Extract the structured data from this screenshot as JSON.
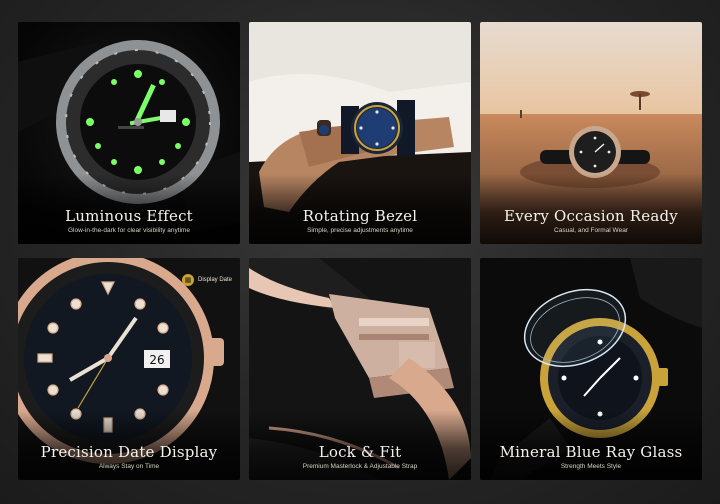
{
  "tiles": [
    {
      "title": "Luminous Effect",
      "subtitle": "Glow-in-the-dark for clear visibility anytime"
    },
    {
      "title": "Rotating Bezel",
      "subtitle": "Simple, precise adjustments anytime"
    },
    {
      "title": "Every Occasion Ready",
      "subtitle": "Casual, and Formal Wear"
    },
    {
      "title": "Precision Date Display",
      "subtitle": "Always Stay on Time",
      "callout": "Display Date",
      "callout_icon": "calendar-icon"
    },
    {
      "title": "Lock & Fit",
      "subtitle": "Premium Masterlock & Adjustable Strap"
    },
    {
      "title": "Mineral Blue Ray Glass",
      "subtitle": "Strength Meets Style"
    }
  ],
  "colors": {
    "lume": "#7dff6a",
    "gold": "#c9a33a",
    "rose_gold": "#d9a98e",
    "background": "#262626"
  }
}
